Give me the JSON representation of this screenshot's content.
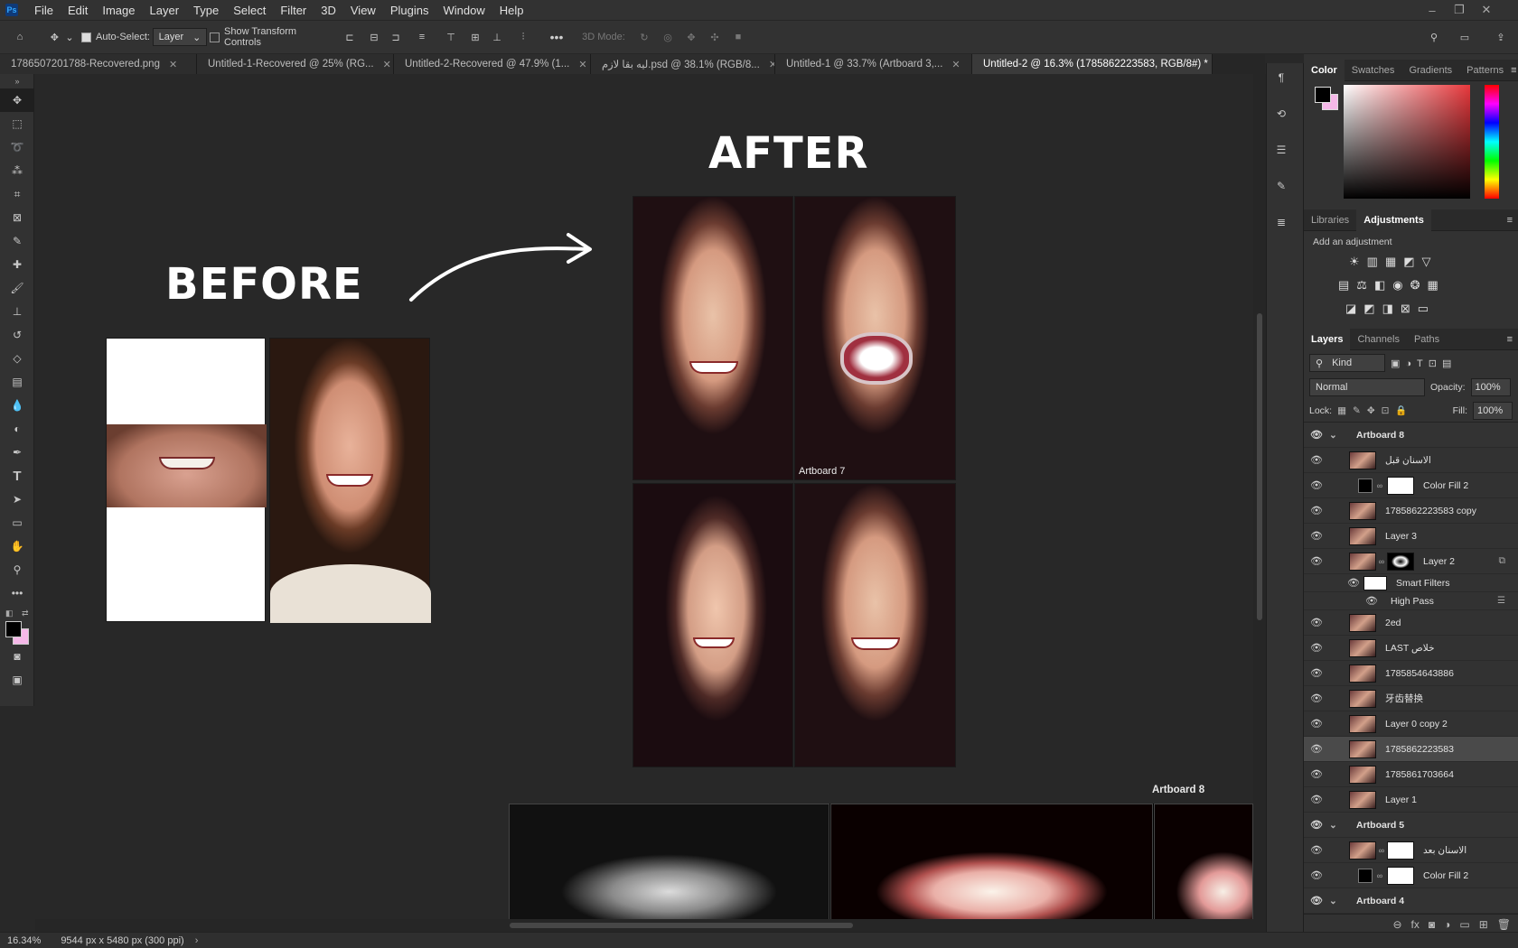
{
  "app": {
    "logo": "Ps"
  },
  "menu": [
    "File",
    "Edit",
    "Image",
    "Layer",
    "Type",
    "Select",
    "Filter",
    "3D",
    "View",
    "Plugins",
    "Window",
    "Help"
  ],
  "options": {
    "auto_select_label": "Auto-Select:",
    "auto_select_value": "Layer",
    "transform_label": "Show Transform Controls",
    "mode_3d": "3D Mode:",
    "more": "•••"
  },
  "tabs": [
    {
      "label": "1786507201788-Recovered.png",
      "active": false
    },
    {
      "label": "Untitled-1-Recovered @ 25% (RG...",
      "active": false
    },
    {
      "label": "Untitled-2-Recovered @ 47.9% (1...",
      "active": false
    },
    {
      "label": "ليه بقا لازم.psd @ 38.1% (RGB/8...",
      "active": false
    },
    {
      "label": "Untitled-1 @ 33.7% (Artboard 3,...",
      "active": false
    },
    {
      "label": "Untitled-2 @ 16.3% (1785862223583, RGB/8#) *",
      "active": true
    }
  ],
  "canvas": {
    "before": "BEFORE",
    "after": "AFTER",
    "artboard7": "Artboard 7",
    "artboard8": "Artboard 8"
  },
  "colorpanel": {
    "tabs": [
      "Color",
      "Swatches",
      "Gradients",
      "Patterns"
    ],
    "fg": "#000000",
    "bg": "#f5b8e8"
  },
  "adjpanel": {
    "tabs": [
      "Libraries",
      "Adjustments"
    ],
    "hint": "Add an adjustment"
  },
  "layerspanel": {
    "tabs": [
      "Layers",
      "Channels",
      "Paths"
    ],
    "kind": "Kind",
    "blend": "Normal",
    "opacity_label": "Opacity:",
    "opacity": "100%",
    "lock_label": "Lock:",
    "fill_label": "Fill:",
    "fill": "100%",
    "rows": [
      {
        "name": "Artboard 8",
        "type": "group"
      },
      {
        "name": "الاسنان قبل",
        "type": "img"
      },
      {
        "name": "Color Fill 2",
        "type": "fill"
      },
      {
        "name": "1785862223583 copy",
        "type": "img"
      },
      {
        "name": "Layer 3",
        "type": "img"
      },
      {
        "name": "Layer 2",
        "type": "mask"
      },
      {
        "name": "Smart Filters",
        "type": "sf"
      },
      {
        "name": "High Pass",
        "type": "hp"
      },
      {
        "name": "2ed",
        "type": "img"
      },
      {
        "name": "LAST خلاص",
        "type": "img"
      },
      {
        "name": "1785854643886",
        "type": "img"
      },
      {
        "name": "牙齿替换",
        "type": "img"
      },
      {
        "name": "Layer 0 copy 2",
        "type": "img"
      },
      {
        "name": "1785862223583",
        "type": "img",
        "selected": true
      },
      {
        "name": "1785861703664",
        "type": "img"
      },
      {
        "name": "Layer 1",
        "type": "img"
      },
      {
        "name": "Artboard 5",
        "type": "group"
      },
      {
        "name": "الاسنان بعد",
        "type": "fillimg"
      },
      {
        "name": "Color Fill 2",
        "type": "fill"
      },
      {
        "name": "Artboard 4",
        "type": "group"
      }
    ]
  },
  "status": {
    "zoom": "16.34%",
    "doc": "9544 px x 5480 px (300 ppi)"
  }
}
